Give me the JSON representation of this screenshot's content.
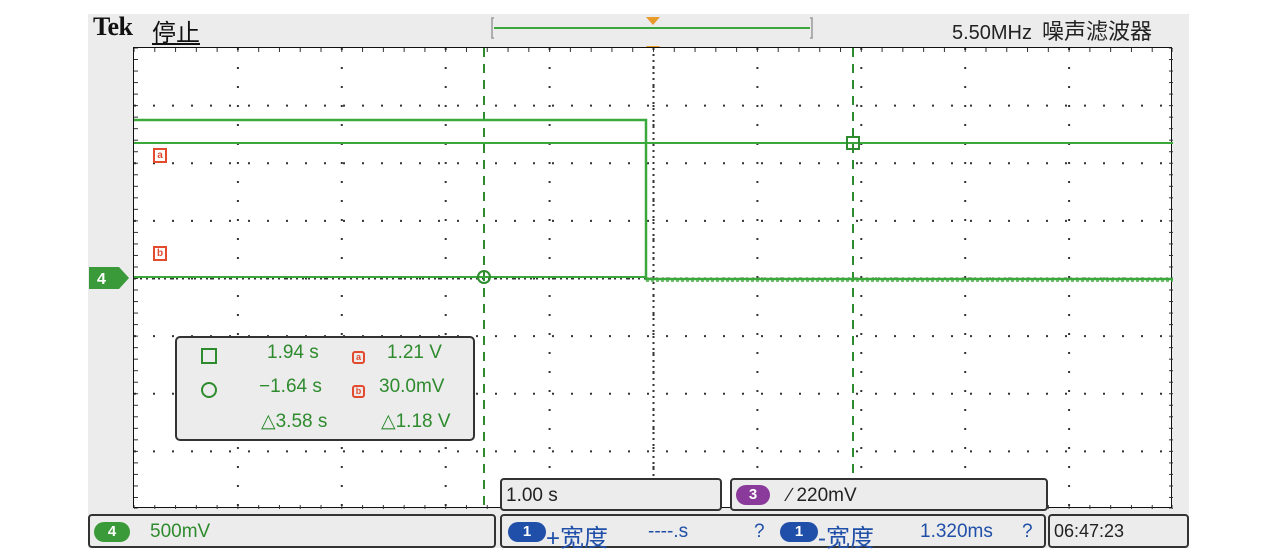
{
  "header": {
    "brand": "Tek",
    "run_state": "停止",
    "filter_freq": "5.50MHz",
    "filter_label": "噪声滤波器"
  },
  "channel_marker": {
    "label": "4"
  },
  "ref_markers": {
    "a": "a",
    "b": "b"
  },
  "cursors": {
    "t1": "1.94 s",
    "v1": "1.21 V",
    "t2": "−1.64 s",
    "v2": "30.0mV",
    "dt": "△3.58 s",
    "dv": "△1.18 V"
  },
  "timebase": {
    "value": "1.00 s"
  },
  "trigger": {
    "source": "3",
    "level": "∕ 220mV"
  },
  "ch4_scale": {
    "channel": "4",
    "value": "500mV"
  },
  "measurements": {
    "pos_channel": "1",
    "pos_label": "+宽度",
    "pos_value": "----.s",
    "pos_status": "?",
    "neg_channel": "1",
    "neg_label": "-宽度",
    "neg_value": "1.320ms",
    "neg_status": "?"
  },
  "clock": {
    "time": "06:47:23"
  },
  "colors": {
    "trace": "#3aa83a",
    "cursor": "#2e8b2e",
    "ref": "#e24b2e",
    "ch3": "#8a3a9a",
    "ch1": "#1f4fa8",
    "ch4": "#3a9a3a",
    "trigger_marker": "#e89a2a"
  }
}
